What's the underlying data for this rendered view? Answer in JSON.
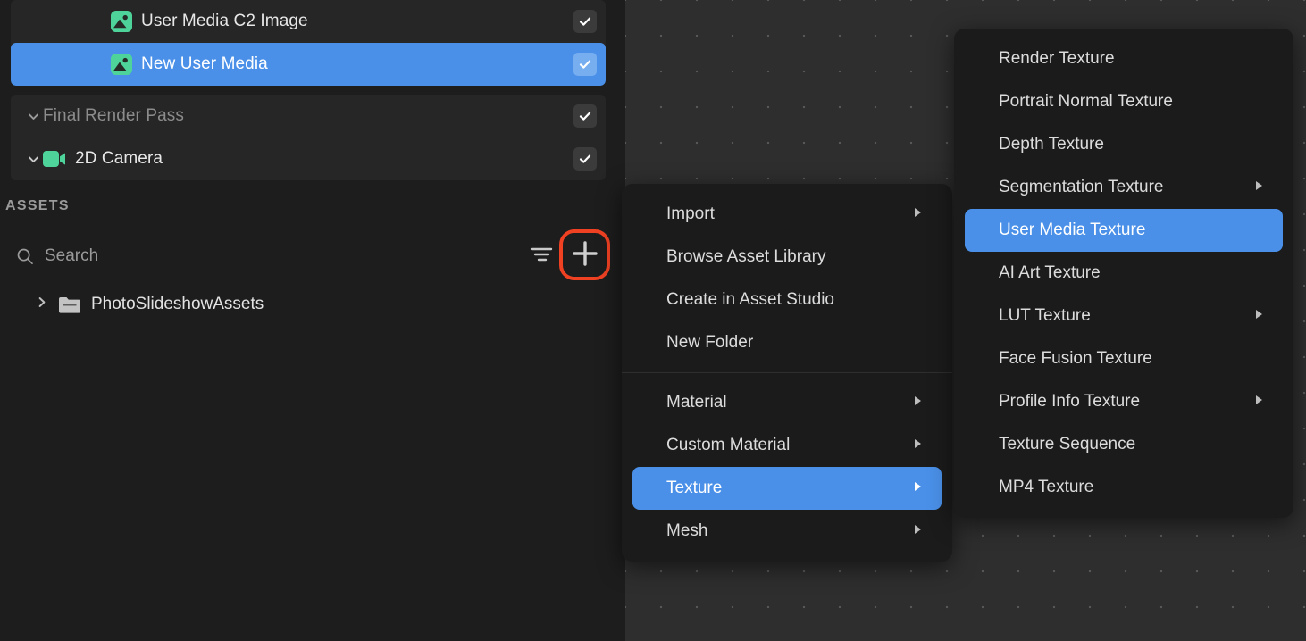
{
  "theme": {
    "accent": "#4a90e8",
    "highlight_ring": "#f04123",
    "panel_bg": "#262626",
    "app_bg": "#1d1d1d",
    "menu_bg": "#1b1b1b",
    "canvas_bg": "#2e2e2e",
    "icon_green": "#4ed49a",
    "text_primary": "#e8e8e8",
    "text_dim": "#8c8c8c"
  },
  "hierarchy": {
    "groups": [
      {
        "rows": [
          {
            "label": "User Media C2 Image",
            "icon": "image-icon",
            "indent": 1,
            "caret": "none",
            "checked": true,
            "selected": false,
            "dim": false
          },
          {
            "label": "New User Media",
            "icon": "image-icon",
            "indent": 1,
            "caret": "none",
            "checked": true,
            "selected": true,
            "dim": false
          }
        ]
      },
      {
        "rows": [
          {
            "label": "Final Render Pass",
            "icon": "none",
            "indent": 0,
            "caret": "chevron-down-icon",
            "checked": true,
            "selected": false,
            "dim": true
          },
          {
            "label": "2D Camera",
            "icon": "camera-icon",
            "indent": 0,
            "caret": "chevron-down-icon",
            "checked": true,
            "selected": false,
            "dim": false
          }
        ]
      }
    ]
  },
  "assets": {
    "title": "ASSETS",
    "search": {
      "value": "",
      "placeholder": "Search",
      "icon": "search-icon"
    },
    "filter_icon": "filter-sort-icon",
    "add_icon": "plus-icon",
    "tree": [
      {
        "label": "PhotoSlideshowAssets",
        "icon": "folder-icon",
        "twisty": "chevron-right-icon",
        "expanded": false
      }
    ]
  },
  "context_menu": {
    "items": [
      {
        "label": "Import",
        "submenu": true,
        "active": false,
        "separator_after": false
      },
      {
        "label": "Browse Asset Library",
        "submenu": false,
        "active": false,
        "separator_after": false
      },
      {
        "label": "Create in Asset Studio",
        "submenu": false,
        "active": false,
        "separator_after": false
      },
      {
        "label": "New Folder",
        "submenu": false,
        "active": false,
        "separator_after": true
      },
      {
        "label": "Material",
        "submenu": true,
        "active": false,
        "separator_after": false
      },
      {
        "label": "Custom Material",
        "submenu": true,
        "active": false,
        "separator_after": false
      },
      {
        "label": "Texture",
        "submenu": true,
        "active": true,
        "separator_after": false
      },
      {
        "label": "Mesh",
        "submenu": true,
        "active": false,
        "separator_after": false
      }
    ]
  },
  "texture_submenu": {
    "items": [
      {
        "label": "Render Texture",
        "submenu": false,
        "active": false
      },
      {
        "label": "Portrait Normal Texture",
        "submenu": false,
        "active": false
      },
      {
        "label": "Depth Texture",
        "submenu": false,
        "active": false
      },
      {
        "label": "Segmentation Texture",
        "submenu": true,
        "active": false
      },
      {
        "label": "User Media Texture",
        "submenu": false,
        "active": true
      },
      {
        "label": "AI Art Texture",
        "submenu": false,
        "active": false
      },
      {
        "label": "LUT Texture",
        "submenu": true,
        "active": false
      },
      {
        "label": "Face Fusion Texture",
        "submenu": false,
        "active": false
      },
      {
        "label": "Profile Info Texture",
        "submenu": true,
        "active": false
      },
      {
        "label": "Texture Sequence",
        "submenu": false,
        "active": false
      },
      {
        "label": "MP4 Texture",
        "submenu": false,
        "active": false
      }
    ]
  }
}
